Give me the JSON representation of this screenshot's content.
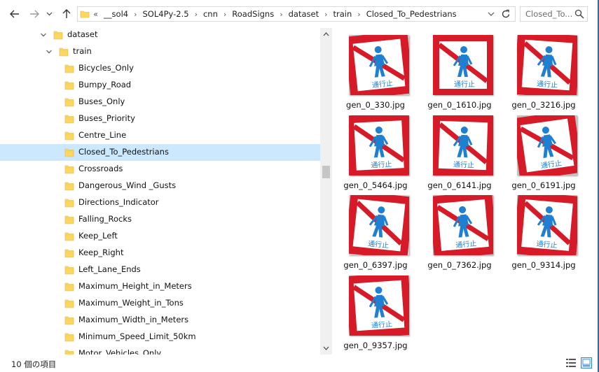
{
  "nav": {
    "back_icon": "arrow-left-icon",
    "forward_icon": "arrow-right-icon",
    "recent_icon": "chevron-down-icon",
    "up_icon": "arrow-up-icon"
  },
  "address": {
    "overflow": "«",
    "crumbs": [
      "__sol4",
      "SOL4Py-2.5",
      "cnn",
      "RoadSigns",
      "dataset",
      "train",
      "Closed_To_Pedestrians"
    ],
    "separator": "›"
  },
  "search": {
    "placeholder": "Closed_To..."
  },
  "tree": {
    "parents": [
      {
        "label": "dataset",
        "expanded": true
      },
      {
        "label": "train",
        "expanded": true
      }
    ],
    "children": [
      "Bicycles_Only",
      "Bumpy_Road",
      "Buses_Only",
      "Buses_Priority",
      "Centre_Line",
      "Closed_To_Pedestrians",
      "Crossroads",
      "Dangerous_Wind _Gusts",
      "Directions_Indicator",
      "Falling_Rocks",
      "Keep_Left",
      "Keep_Right",
      "Left_Lane_Ends",
      "Maximum_Height_in_Meters",
      "Maximum_Weight_in_Tons",
      "Maximum_Width_in_Meters",
      "Minimum_Speed_Limit_50km",
      "Motor_Vehicles_Only"
    ],
    "selected": "Closed_To_Pedestrians"
  },
  "files": [
    {
      "name": "gen_0_330.jpg",
      "sign_text": "通行止"
    },
    {
      "name": "gen_0_1610.jpg",
      "sign_text": "通行止"
    },
    {
      "name": "gen_0_3216.jpg",
      "sign_text": "通行止"
    },
    {
      "name": "gen_0_5464.jpg",
      "sign_text": "通行止"
    },
    {
      "name": "gen_0_6141.jpg",
      "sign_text": "通行止"
    },
    {
      "name": "gen_0_6191.jpg",
      "sign_text": "通行止"
    },
    {
      "name": "gen_0_6397.jpg",
      "sign_text": "通行止"
    },
    {
      "name": "gen_0_7362.jpg",
      "sign_text": "通行止"
    },
    {
      "name": "gen_0_9314.jpg",
      "sign_text": "通行止"
    },
    {
      "name": "gen_0_9357.jpg",
      "sign_text": "通行止"
    }
  ],
  "status": {
    "count": "10 個の項目"
  },
  "colors": {
    "selection": "#cce8ff",
    "folder": "#ffd75e",
    "sign_red": "#d71a28",
    "sign_blue": "#1f7fd0",
    "accent": "#1f6fc5"
  }
}
